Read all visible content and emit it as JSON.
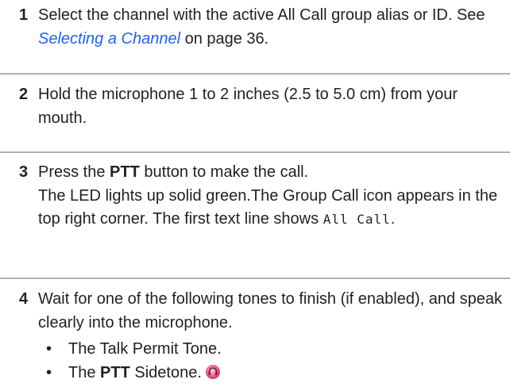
{
  "steps": [
    {
      "number": "1",
      "text_before": "Select the channel with the active All Call group alias or ID. See ",
      "link": "Selecting a Channel",
      "text_after": " on page 36."
    },
    {
      "number": "2",
      "text": "Hold the microphone 1 to 2 inches (2.5 to 5.0 cm) from your mouth."
    },
    {
      "number": "3",
      "press": "Press the ",
      "ptt": "PTT",
      "press_after": " button to make the call.",
      "led": "The LED lights up solid green.The Group Call icon appears in the top right corner. The first text line shows ",
      "display_text": "All Call",
      "period": "."
    },
    {
      "number": "4",
      "text": "Wait for one of the following tones to finish (if enabled), and speak clearly into the microphone.",
      "bullets": [
        {
          "text": "The Talk Permit Tone."
        },
        {
          "pre": "The ",
          "bold": "PTT",
          "post": " Sidetone."
        }
      ],
      "bullet_glyph": "•",
      "sidetone_icon": "sidetone-icon",
      "icon_color": "#e0507a"
    }
  ],
  "colors": {
    "link": "#1f62f4",
    "divider": "#a7b1c0",
    "text": "#231f20"
  }
}
